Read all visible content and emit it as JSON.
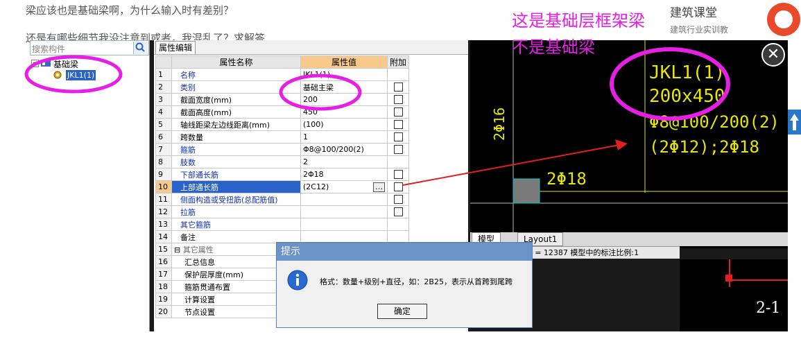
{
  "background": {
    "question_line1": "梁应该也是基础梁啊，为什么输入时有差别？",
    "question_line2": "还是有哪些细节我没注意到或者，我混乱了？求解答",
    "side_title": "建筑课堂",
    "side_sub": "建筑行业实训教"
  },
  "tree": {
    "search_placeholder": "搜索构件",
    "root_label": "基础梁",
    "child_label": "JKL1(1)"
  },
  "grid": {
    "tab_label": "属性编辑",
    "col_name": "属性名称",
    "col_value": "属性值",
    "col_add": "附加",
    "rows": [
      {
        "num": "1",
        "name": "名称",
        "value": "JKL1(1)",
        "blue": true,
        "cb": false
      },
      {
        "num": "2",
        "name": "类别",
        "value": "基础主梁",
        "blue": true,
        "cb": true
      },
      {
        "num": "3",
        "name": "截面宽度(mm)",
        "value": "200",
        "blue": false,
        "cb": true
      },
      {
        "num": "4",
        "name": "截面高度(mm)",
        "value": "450",
        "blue": false,
        "cb": true
      },
      {
        "num": "5",
        "name": "轴线距梁左边线距离(mm)",
        "value": "(100)",
        "blue": false,
        "cb": true
      },
      {
        "num": "6",
        "name": "跨数量",
        "value": "1",
        "blue": false,
        "cb": true
      },
      {
        "num": "7",
        "name": "箍筋",
        "value": "Φ8@100/200(2)",
        "blue": true,
        "cb": true
      },
      {
        "num": "8",
        "name": "肢数",
        "value": "2",
        "blue": true,
        "cb": false
      },
      {
        "num": "9",
        "name": "下部通长筋",
        "value": "2Φ18",
        "blue": true,
        "cb": true
      },
      {
        "num": "10",
        "name": "上部通长筋",
        "value": "(2C12)",
        "blue": false,
        "cb": true,
        "sel": true
      },
      {
        "num": "11",
        "name": "侧面构造或受扭筋(总配筋值)",
        "value": "",
        "blue": true,
        "cb": true
      },
      {
        "num": "12",
        "name": "拉筋",
        "value": "",
        "blue": true,
        "cb": true
      },
      {
        "num": "13",
        "name": "其它箍筋",
        "value": "",
        "blue": true,
        "cb": false
      },
      {
        "num": "14",
        "name": "备注",
        "value": "",
        "blue": false,
        "cb": false
      },
      {
        "num": "15",
        "name": "其它属性",
        "value": "",
        "blue": false,
        "cb": false,
        "group": true
      },
      {
        "num": "16",
        "name": "汇总信息",
        "value": "",
        "blue": false,
        "cb": false,
        "child": true
      },
      {
        "num": "17",
        "name": "保护层厚度(mm)",
        "value": "",
        "blue": false,
        "cb": false,
        "child": true
      },
      {
        "num": "18",
        "name": "箍筋贯通布置",
        "value": "",
        "blue": false,
        "cb": false,
        "child": true
      },
      {
        "num": "19",
        "name": "计算设置",
        "value": "",
        "blue": false,
        "cb": false,
        "child": true
      },
      {
        "num": "20",
        "name": "节点设置",
        "value": "",
        "blue": false,
        "cb": false,
        "child": true
      }
    ]
  },
  "cad": {
    "label1": "JKL1(1)",
    "label2": "200x450",
    "label3": "Φ8@100/200(2)",
    "label4": "(2Φ12);2Φ18",
    "bottom_bar": "2Φ18",
    "vertical": "2Φ16",
    "tab_model": "模型",
    "tab_layout": "Layout1",
    "status": "x = 3034614 y = 12387  模型中的标注比例:1",
    "bottom_right": "2-1"
  },
  "annotation": {
    "line1": "这是基础层框架梁",
    "line2": "不是基础梁"
  },
  "dialog": {
    "title": "提示",
    "message": "格式：数量+级别+直径，如：2B25，表示从首跨到尾跨",
    "ok": "确定"
  },
  "colors": {
    "annotation": "#e61ee6",
    "cad_text": "#e6e600",
    "accent": "#2a62c8"
  }
}
